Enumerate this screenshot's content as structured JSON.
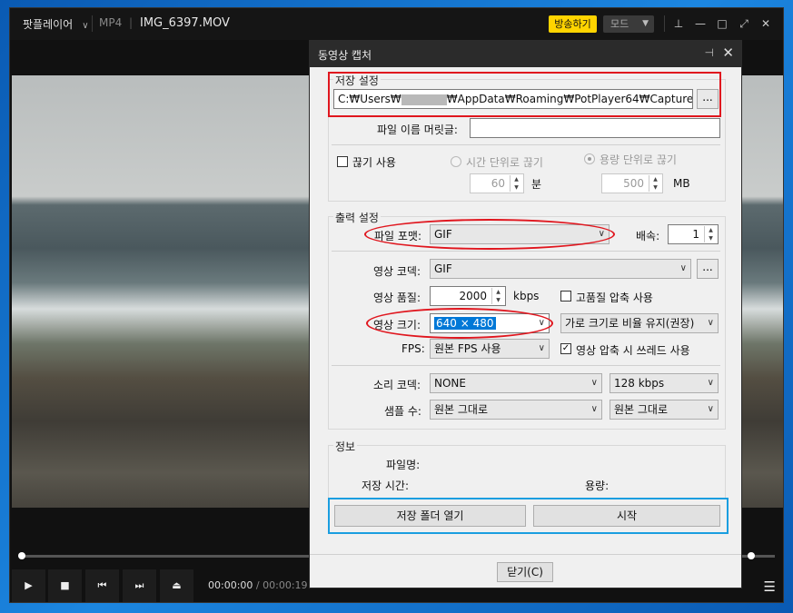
{
  "player": {
    "app_name": "팟플레이어",
    "format": "MP4",
    "separator": "|",
    "filename": "IMG_6397.MOV",
    "broadcast_label": "방송하기",
    "mode_label": "모드",
    "time_current": "00:00:00",
    "time_separator": "/",
    "time_total": "00:00:19"
  },
  "dialog": {
    "title": "동영상 캡처",
    "save": {
      "group_label": "저장 설정",
      "path_prefix": "C:₩Users₩",
      "path_suffix": "₩AppData₩Roaming₩PotPlayer64₩Capture",
      "browse_label": "...",
      "prefix_label": "파일 이름 머릿글:",
      "prefix_value": "",
      "split_label": "끊기 사용",
      "split_checked": false,
      "time_split_label": "시간 단위로 끊기",
      "time_value": "60",
      "time_unit": "분",
      "size_split_label": "용량 단위로 끊기",
      "size_value": "500",
      "size_unit": "MB"
    },
    "output": {
      "group_label": "출력 설정",
      "format_label": "파일 포맷:",
      "format_value": "GIF",
      "speed_label": "배속:",
      "speed_value": "1",
      "codec_label": "영상 코덱:",
      "codec_value": "GIF",
      "codec_browse": "...",
      "quality_label": "영상 품질:",
      "quality_value": "2000",
      "quality_unit": "kbps",
      "hq_label": "고품질 압축 사용",
      "hq_checked": false,
      "size_label": "영상 크기:",
      "size_value": "640 × 480",
      "ratio_value": "가로 크기로 비율 유지(권장)",
      "fps_label": "FPS:",
      "fps_value": "원본 FPS 사용",
      "thread_label": "영상 압축 시 쓰레드 사용",
      "thread_checked": true,
      "audio_codec_label": "소리 코덱:",
      "audio_codec_value": "NONE",
      "audio_bitrate_value": "128 kbps",
      "sample_label": "샘플 수:",
      "sample_value": "원본 그대로",
      "channel_value": "원본 그대로"
    },
    "info": {
      "group_label": "정보",
      "filename_label": "파일명:",
      "time_label": "저장 시간:",
      "size_label": "용량:"
    },
    "open_folder_label": "저장 폴더 열기",
    "start_label": "시작",
    "close_label": "닫기(C)"
  }
}
